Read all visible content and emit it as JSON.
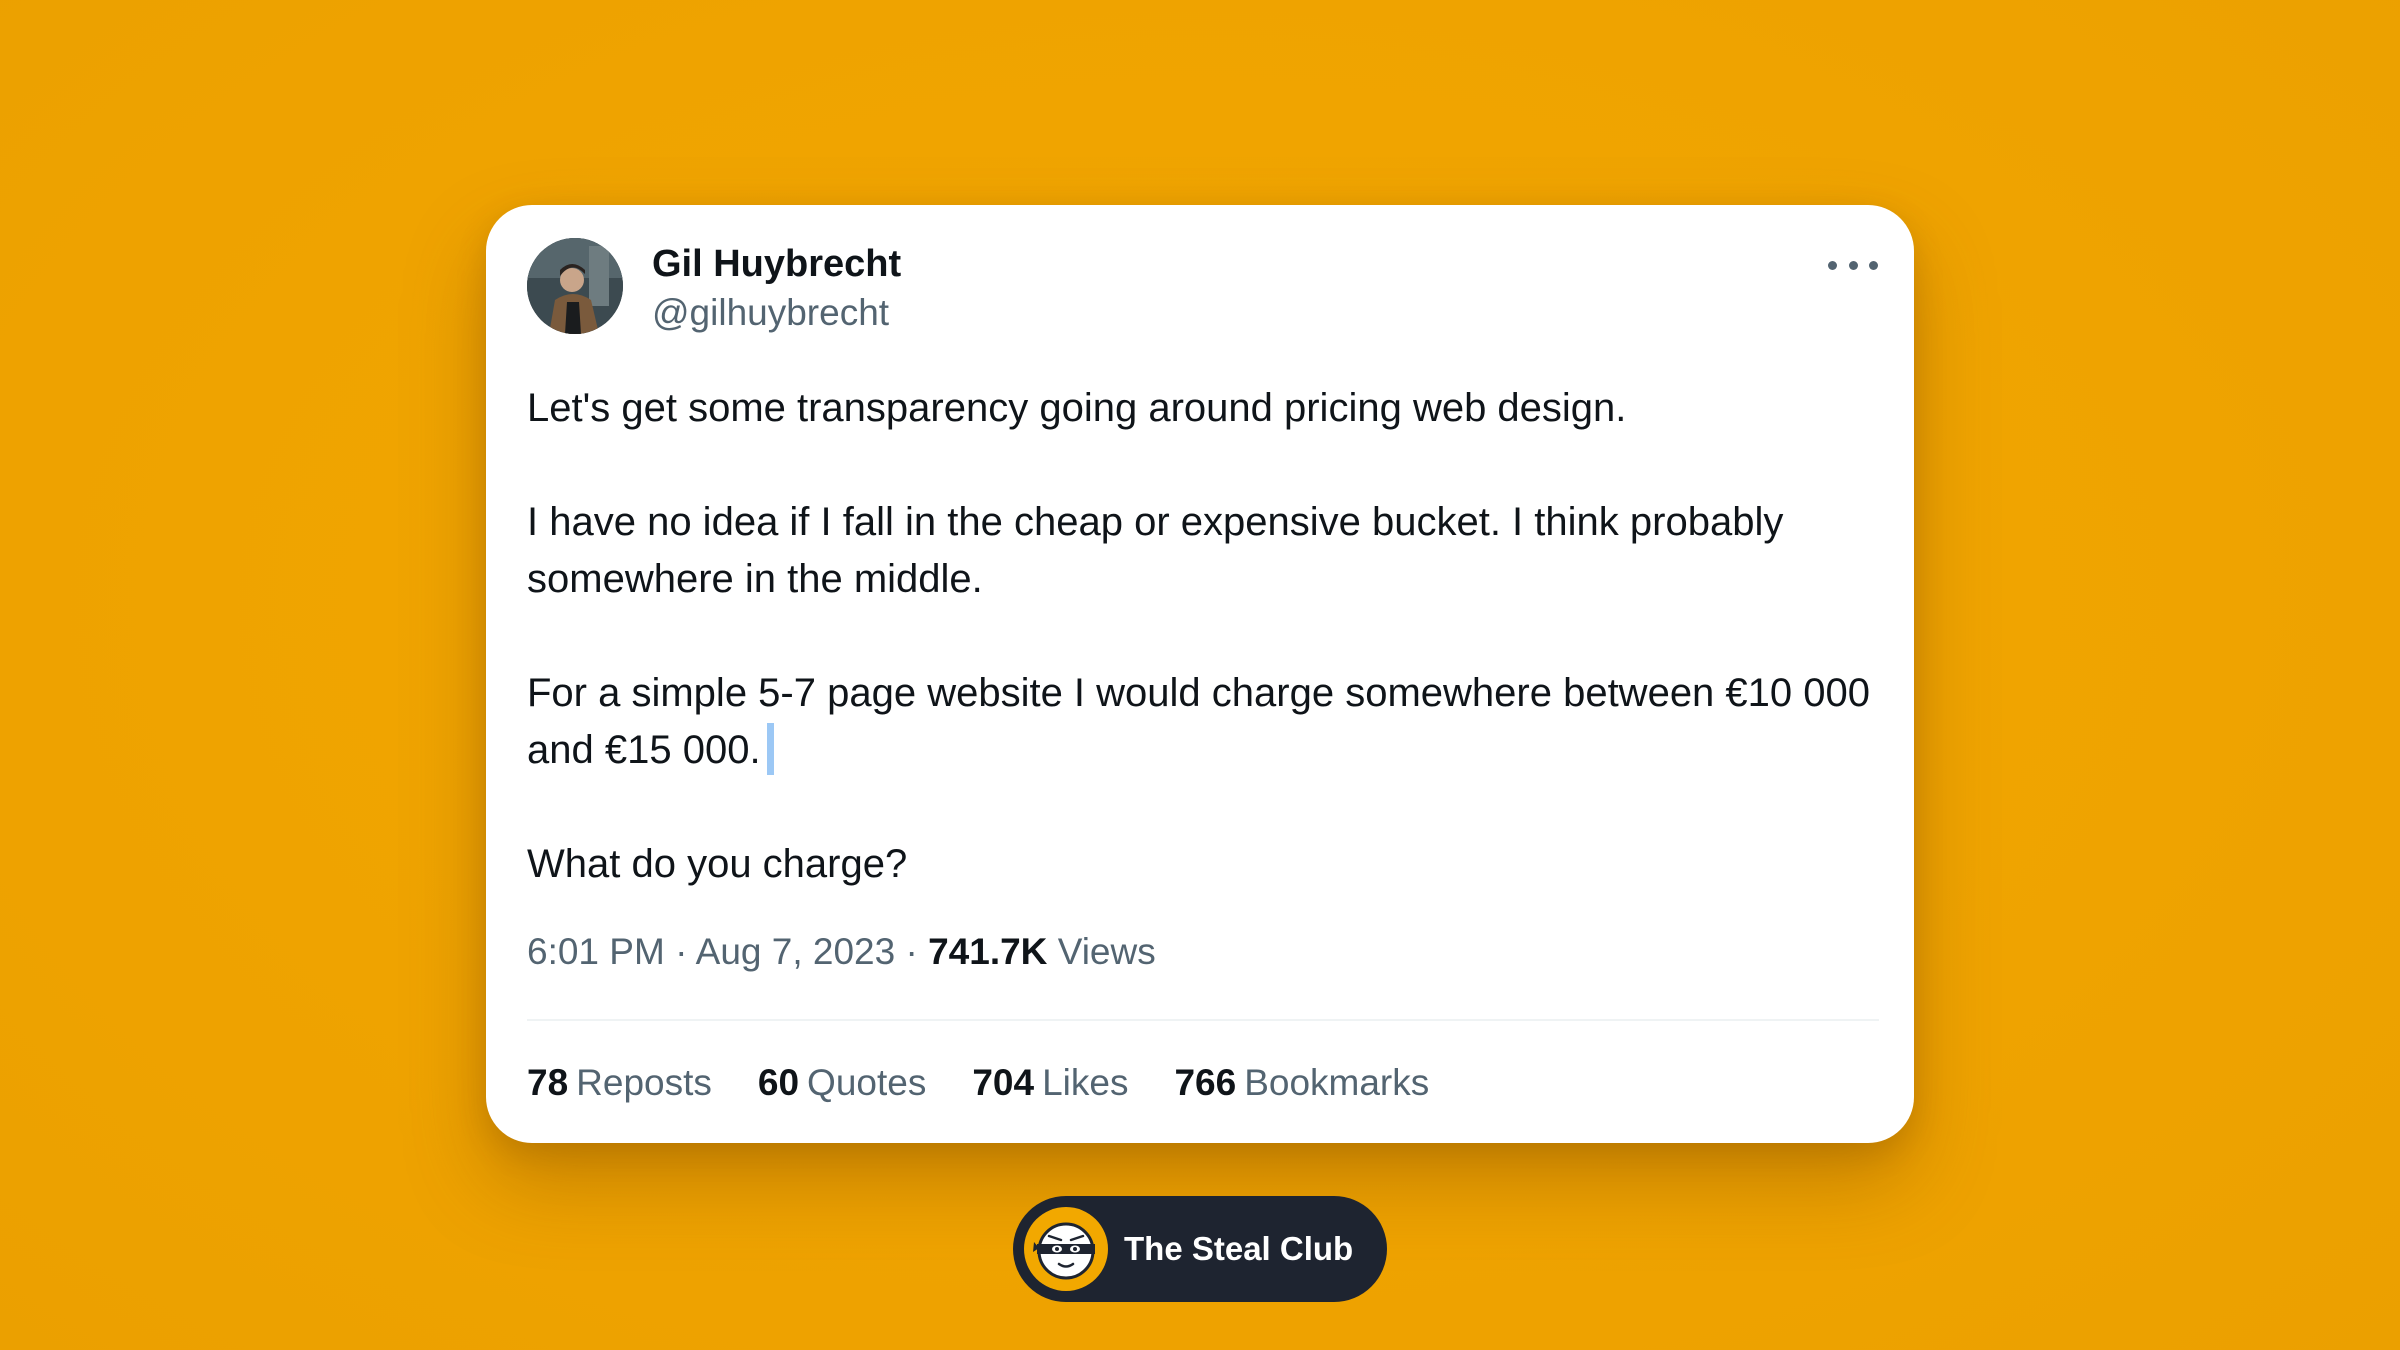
{
  "tweet": {
    "author_name": "Gil Huybrecht",
    "author_handle": "@gilhuybrecht",
    "paragraphs": [
      "Let's get some transparency going around pricing web design.",
      "I have no idea if I fall in the cheap or expensive bucket. I think probably somewhere in the middle.",
      "For a simple 5-7 page website I would charge somewhere between €10 000 and €15 000.",
      "What do you charge?"
    ],
    "time": "6:01 PM",
    "date": "Aug 7, 2023",
    "views_count": "741.7K",
    "views_label": "Views",
    "stats": [
      {
        "count": "78",
        "label": "Reposts"
      },
      {
        "count": "60",
        "label": "Quotes"
      },
      {
        "count": "704",
        "label": "Likes"
      },
      {
        "count": "766",
        "label": "Bookmarks"
      }
    ]
  },
  "badge": {
    "label": "The Steal Club"
  },
  "colors": {
    "background": "#F0A500",
    "card": "#FFFFFF",
    "text_primary": "#0F1419",
    "text_secondary": "#536471",
    "badge_bg": "#1E2430"
  }
}
